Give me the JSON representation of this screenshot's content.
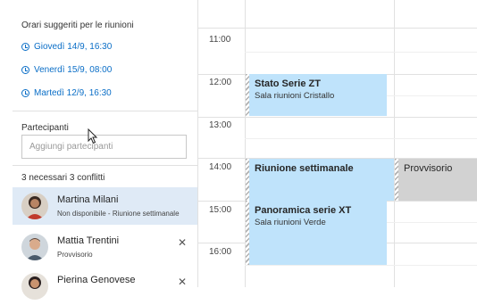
{
  "panel": {
    "suggested_title": "Orari suggeriti per le riunioni",
    "suggestions": [
      "Giovedì 14/9, 16:30",
      "Venerdì 15/9, 08:00",
      "Martedì 12/9, 16:30"
    ],
    "participants_label": "Partecipanti",
    "add_placeholder": "Aggiungi partecipanti",
    "summary": "3 necessari 3 conflitti",
    "people": [
      {
        "name": "Martina Milani",
        "status": "Non disponibile - Riunione settimanale"
      },
      {
        "name": "Mattia Trentini",
        "status": "Provvisorio",
        "remove": "✕"
      },
      {
        "name": "Pierina Genovese",
        "status": "",
        "remove": "✕"
      }
    ]
  },
  "calendar": {
    "times": [
      "11:00",
      "12:00",
      "13:00",
      "14:00",
      "15:00",
      "16:00"
    ],
    "events": [
      {
        "title": "Stato Serie ZT",
        "location": "Sala riunioni Cristallo"
      },
      {
        "title": "Riunione settimanale",
        "location": ""
      },
      {
        "title": "Provvisorio",
        "location": ""
      },
      {
        "title": "Panoramica serie XT",
        "location": "Sala riunioni Verde"
      }
    ]
  },
  "colors": {
    "accent": "#0a6ec7",
    "busy": "#bfe3fb",
    "tentative": "#d2d2d2",
    "selected": "#dfeaf6"
  }
}
